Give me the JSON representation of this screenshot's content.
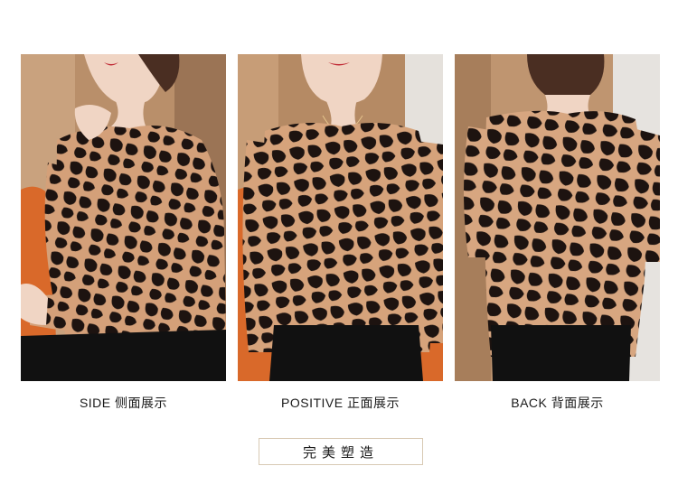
{
  "panels": [
    {
      "caption": "SIDE 侧面展示",
      "photo": "model-side-view"
    },
    {
      "caption": "POSITIVE 正面展示",
      "photo": "model-front-view"
    },
    {
      "caption": "BACK 背面展示",
      "photo": "model-back-view"
    }
  ],
  "tagline": "完美塑造",
  "colors": {
    "pattern_base": "#d4a079",
    "pattern_spots": "#1d1310",
    "trousers": "#111111",
    "chair": "#d9692a",
    "wall": "#b98f6a"
  }
}
